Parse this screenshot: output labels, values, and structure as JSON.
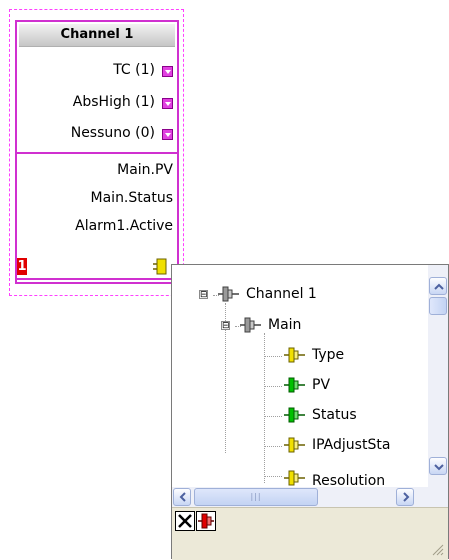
{
  "block": {
    "title": "Channel 1",
    "inputs": [
      "TC (1)",
      "AbsHigh (1)",
      "Nessuno (0)"
    ],
    "outputs": [
      "Main.PV",
      "Main.Status",
      "Alarm1.Active"
    ],
    "badge": "1",
    "accent_color": "#d030d0",
    "badge_color": "#e00000"
  },
  "tree": {
    "root": {
      "label": "Channel 1",
      "icon": "connector-gray-icon",
      "expander": "⊟"
    },
    "group": {
      "label": "Main",
      "icon": "connector-gray-icon",
      "expander": "⊟"
    },
    "items": [
      {
        "label": "Type",
        "icon": "connector-yellow-icon",
        "color": "#f0e000"
      },
      {
        "label": "PV",
        "icon": "connector-green-icon",
        "color": "#00c000"
      },
      {
        "label": "Status",
        "icon": "connector-green-icon",
        "color": "#00c000"
      },
      {
        "label": "IPAdjustSta",
        "icon": "connector-yellow-icon",
        "color": "#f0e000"
      },
      {
        "label": "Resolution",
        "icon": "connector-yellow-icon",
        "color": "#f0e000"
      }
    ]
  },
  "toolbar": {
    "close_icon": "close-x-icon",
    "connect_icon": "connector-red-icon"
  }
}
